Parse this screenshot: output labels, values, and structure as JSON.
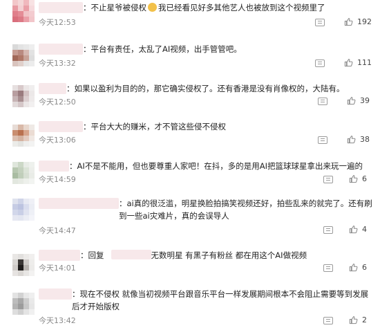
{
  "comments": [
    {
      "text_parts": [
        "：不止星爷被侵权",
        "我已经看见好多其他艺人也被放到这个视频里了"
      ],
      "time": "今天12:53",
      "likes": "192"
    },
    {
      "text": "：平台有责任，太乱了AI视频，出手管管吧。",
      "time": "今天13:32",
      "likes": "111"
    },
    {
      "text": "：如果以盈利为目的的，那它确实侵权了。还有香港是没有肖像权的，大陆有。",
      "time": "今天12:50",
      "likes": "39"
    },
    {
      "text": "：平台大大的赚米，才不管这些侵不侵权",
      "time": "今天13:06",
      "likes": "38"
    },
    {
      "text": "：AI不是不能用，但也要尊重人家吧！在抖，多的是用AI把篮球球星拿出来玩一遍的",
      "time": "今天14:59",
      "likes": "6"
    },
    {
      "text": "：ai真的很泛滥，明星换脸拍搞笑视频还好，拍些乱来的就完了。还有刷到一些ai灾难片，真的会误导人",
      "time": "今天14:47",
      "likes": "4"
    },
    {
      "text_parts": [
        "：回复",
        "无数明星 有黑子有粉丝 都在用这个AI做视频"
      ],
      "time": "今天14:01",
      "likes": "6"
    },
    {
      "text": "：现在不侵权 就像当初视频平台跟音乐平台一样发展期间根本不会阻止需要等到发展后才开始版权",
      "time": "今天13:42",
      "likes": "2"
    }
  ],
  "icons": {
    "reply": "comment-icon",
    "like": "thumbs-up-icon",
    "emoji": "smirk-emoji-icon"
  }
}
